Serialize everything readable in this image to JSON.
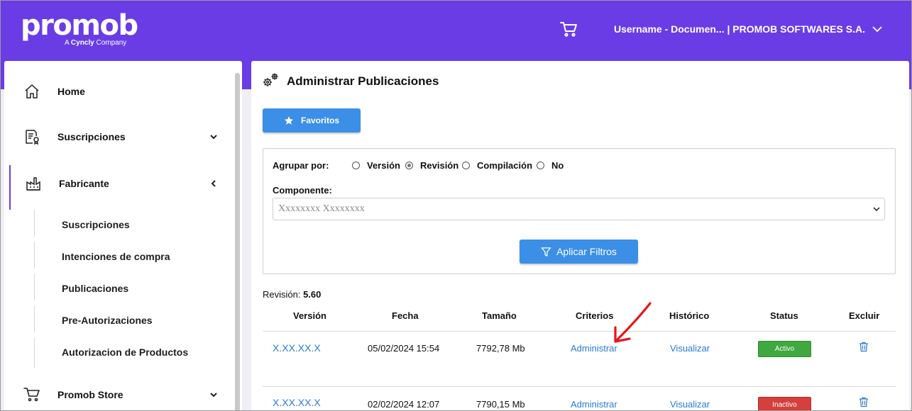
{
  "header": {
    "logo_text": "promob",
    "logo_sub_prefix": "A ",
    "logo_sub_brand": "Cyncly",
    "logo_sub_suffix": " Company",
    "cart_icon": "cart-icon",
    "user_label": "Username - Documen... | PROMOB SOFTWARES S.A."
  },
  "sidebar": {
    "items": [
      {
        "label": "Home",
        "icon": "home-icon"
      },
      {
        "label": "Suscripciones",
        "icon": "certificate-document-icon"
      },
      {
        "label": "Fabricante",
        "icon": "factory-icon"
      },
      {
        "label": "Promob Store",
        "icon": "cart-icon"
      }
    ],
    "sub_items": [
      {
        "label": "Suscripciones"
      },
      {
        "label": "Intenciones de compra"
      },
      {
        "label": "Publicaciones"
      },
      {
        "label": "Pre-Autorizaciones"
      },
      {
        "label": "Autorizacion de Productos"
      }
    ]
  },
  "main": {
    "title": "Administrar Publicaciones",
    "favorites_label": "Favoritos",
    "group_by_label": "Agrupar por:",
    "group_options": [
      "Versión",
      "Revisión",
      "Compilación",
      "No"
    ],
    "group_selected": "Revisión",
    "component_label": "Componente:",
    "component_value": "Xxxxxxxx Xxxxxxxx",
    "apply_label": "Aplicar Filtros",
    "revision_label": "Revisión: ",
    "revision_value": "5.60",
    "table": {
      "headers": [
        "Versión",
        "Fecha",
        "Tamaño",
        "Criterios",
        "Histórico",
        "Status",
        "Excluir"
      ],
      "rows": [
        {
          "version": "X.XX.XX.X",
          "fecha": "05/02/2024 15:54",
          "tamano": "7792,78 Mb",
          "criterios": "Administrar",
          "historico": "Visualizar",
          "status": "Activo"
        },
        {
          "version": "X.XX.XX.X",
          "fecha": "02/02/2024 12:07",
          "tamano": "7790,15 Mb",
          "criterios": "Administrar",
          "historico": "Visualizar",
          "status": "Inactivo"
        }
      ]
    }
  },
  "colors": {
    "brand": "#6a3ce6",
    "button": "#3b8fe6",
    "link": "#2a7bd1",
    "active": "#3fa83f",
    "inactive": "#d4403c",
    "annotation_arrow": "#e8141b"
  }
}
